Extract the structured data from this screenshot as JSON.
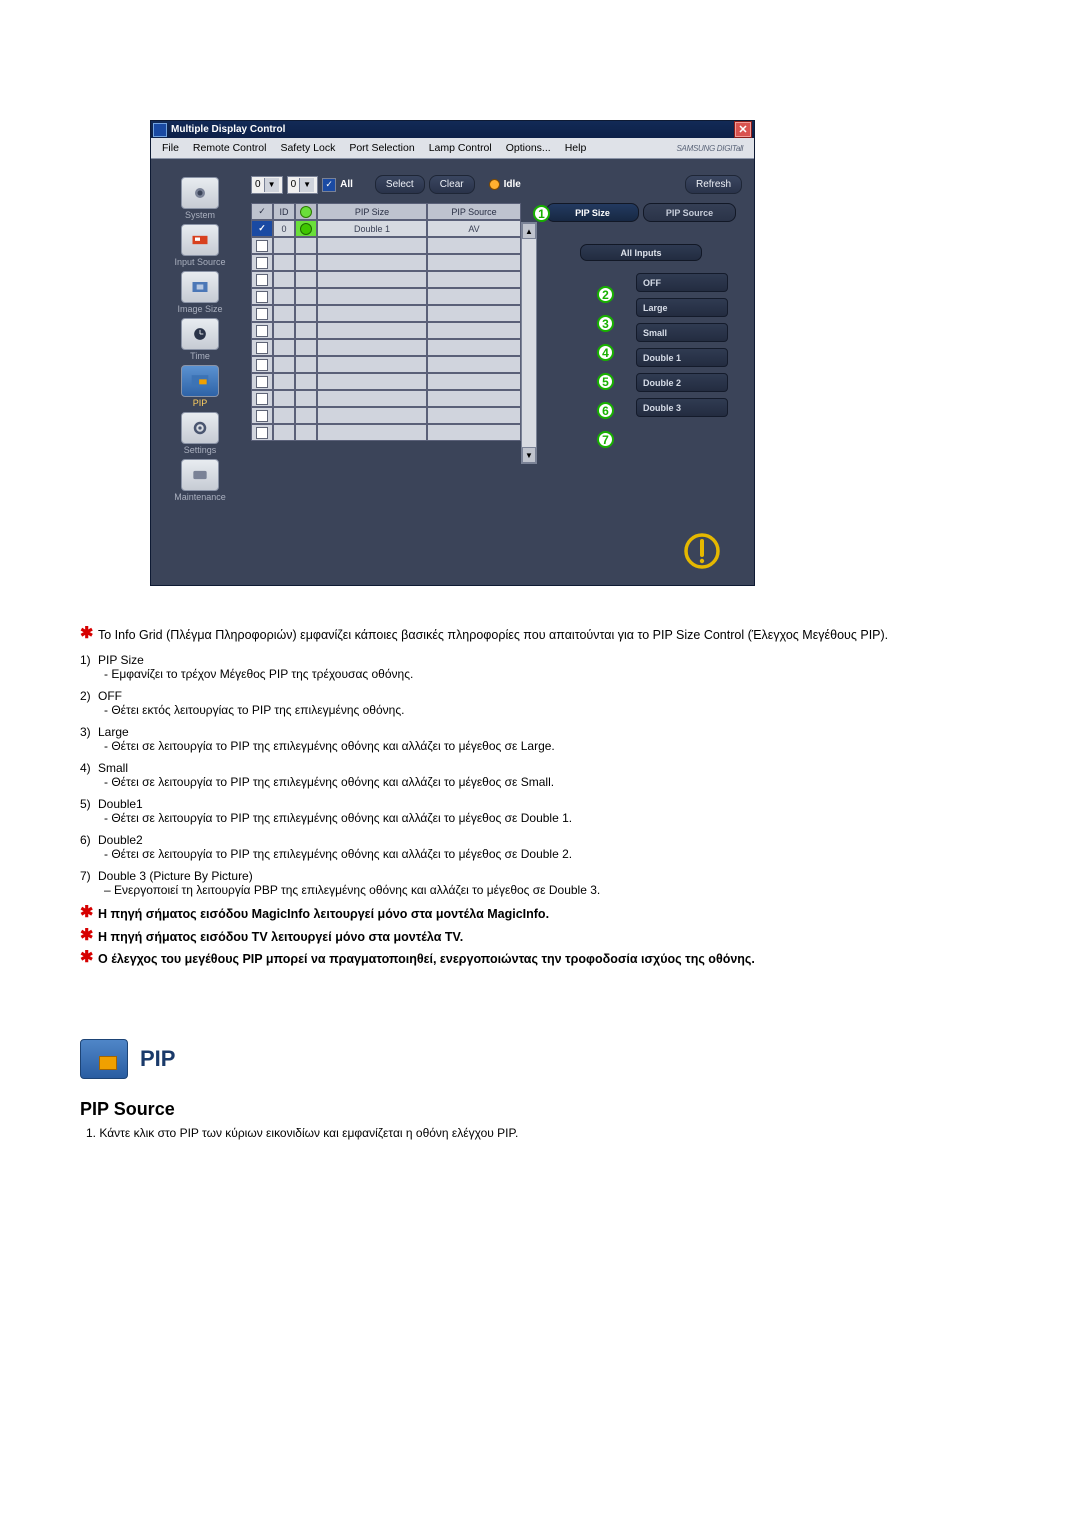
{
  "window": {
    "title": "Multiple Display Control",
    "close": "✕",
    "brand": "SAMSUNG DIGITall"
  },
  "menu": {
    "file": "File",
    "remote": "Remote Control",
    "safety": "Safety Lock",
    "port": "Port Selection",
    "lamp": "Lamp Control",
    "options": "Options...",
    "help": "Help"
  },
  "toolbar": {
    "combo1": "0",
    "combo2": "0",
    "all_label": "All",
    "select": "Select",
    "clear": "Clear",
    "idle": "Idle",
    "refresh": "Refresh"
  },
  "sidebar": {
    "system": "System",
    "input": "Input Source",
    "image": "Image Size",
    "time": "Time",
    "pip": "PIP",
    "settings": "Settings",
    "maint": "Maintenance"
  },
  "grid": {
    "head": {
      "chk": "✓",
      "id": "ID",
      "status": "",
      "size": "PIP Size",
      "source": "PIP Source"
    },
    "row1": {
      "chk": "✓",
      "id": "0",
      "size": "Double 1",
      "source": "AV"
    }
  },
  "rightpanel": {
    "tab_size": "PIP Size",
    "tab_source": "PIP Source",
    "all_inputs": "All Inputs",
    "opts": {
      "off": "OFF",
      "large": "Large",
      "small": "Small",
      "d1": "Double 1",
      "d2": "Double 2",
      "d3": "Double 3"
    }
  },
  "annots": {
    "a1": "1",
    "a2": "2",
    "a3": "3",
    "a4": "4",
    "a5": "5",
    "a6": "6",
    "a7": "7"
  },
  "notes": {
    "intro": "Το Info Grid (Πλέγμα Πληροφοριών) εμφανίζει κάποιες βασικές πληροφορίες που απαιτούνται για το PIP Size Control (Έλεγχος Μεγέθους PIP).",
    "n1t": "PIP Size",
    "n1d": "- Εμφανίζει το τρέχον Μέγεθος PIP της τρέχουσας οθόνης.",
    "n2t": "OFF",
    "n2d": "- Θέτει εκτός λειτουργίας το PIP της επιλεγμένης οθόνης.",
    "n3t": "Large",
    "n3d": "- Θέτει σε λειτουργία το PIP της επιλεγμένης οθόνης και αλλάζει το μέγεθος σε Large.",
    "n4t": "Small",
    "n4d": "- Θέτει σε λειτουργία το PIP της επιλεγμένης οθόνης και αλλάζει το μέγεθος σε Small.",
    "n5t": "Double1",
    "n5d": "- Θέτει σε λειτουργία το PIP της επιλεγμένης οθόνης και αλλάζει το μέγεθος σε Double 1.",
    "n6t": "Double2",
    "n6d": "- Θέτει σε λειτουργία το PIP της επιλεγμένης οθόνης και αλλάζει το μέγεθος σε Double 2.",
    "n7t": "Double 3 (Picture By Picture)",
    "n7d": "– Ενεργοποιεί τη λειτουργία PBP της επιλεγμένης οθόνης και αλλάζει το μέγεθος σε Double 3.",
    "warn1": "Η πηγή σήματος εισόδου MagicInfo λειτουργεί μόνο στα μοντέλα MagicInfo.",
    "warn2": "Η πηγή σήματος εισόδου TV λειτουργεί μόνο στα μοντέλα TV.",
    "warn3": "Ο έλεγχος του μεγέθους PIP μπορεί να πραγματοποιηθεί, ενεργοποιώντας την τροφοδοσία ισχύος της οθόνης.",
    "nums": {
      "n1": "1)",
      "n2": "2)",
      "n3": "3)",
      "n4": "4)",
      "n5": "5)",
      "n6": "6)",
      "n7": "7)"
    }
  },
  "section2": {
    "pip": "PIP",
    "sub": "PIP Source",
    "step_num": "1.",
    "step1": "Κάντε κλικ στο PIP των κύριων εικονιδίων και εμφανίζεται η οθόνη ελέγχου PIP."
  }
}
